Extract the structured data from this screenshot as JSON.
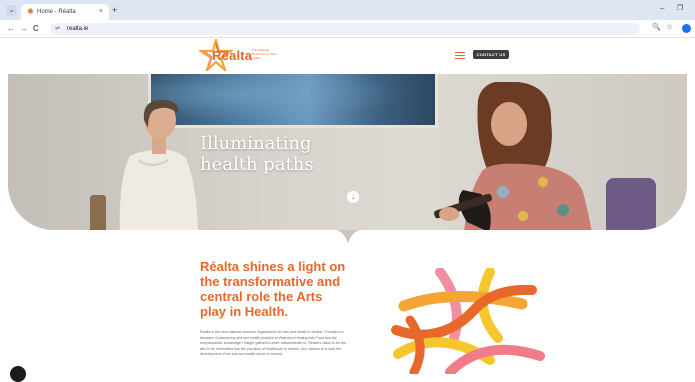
{
  "browser": {
    "tab_title": "Home - Réalta",
    "tab_close_glyph": "×",
    "new_tab_glyph": "+",
    "url": "realta.ie",
    "window_min_glyph": "–",
    "window_restore_glyph": "❐",
    "nav_back_glyph": "←",
    "nav_forward_glyph": "→",
    "nav_reload_glyph": "C",
    "zoom_glyph": "🔍",
    "bookmark_glyph": "☆",
    "tab_menu_glyph": "⌄",
    "site_info_glyph": "⇌",
    "favicon_glyph": "✺"
  },
  "site": {
    "logo_word": "Réalta",
    "logo_tagline": "The National Resource for Arts + Health",
    "contact_label": "CONTACT US",
    "accent": "#e8682b",
    "dark": "#3e3d3c"
  },
  "hero": {
    "title": "Illuminating health paths",
    "scroll_glyph": "↓"
  },
  "intro": {
    "heading": "Réalta shines a light on the transformative and central role the Arts play in Health.",
    "body": "Réalta is the new national resource organisation for arts and health in Ireland. Founded on decades of pioneering arts and health practice at Waterford Healing Arts Trust and the encyclopaedic knowledge / insight gathered under artsandhealth.ie. Réalta's vision is for the arts to be embedded into the provision of healthcare in Ireland. Our mission is to lead the development of the arts and health sector in Ireland."
  }
}
